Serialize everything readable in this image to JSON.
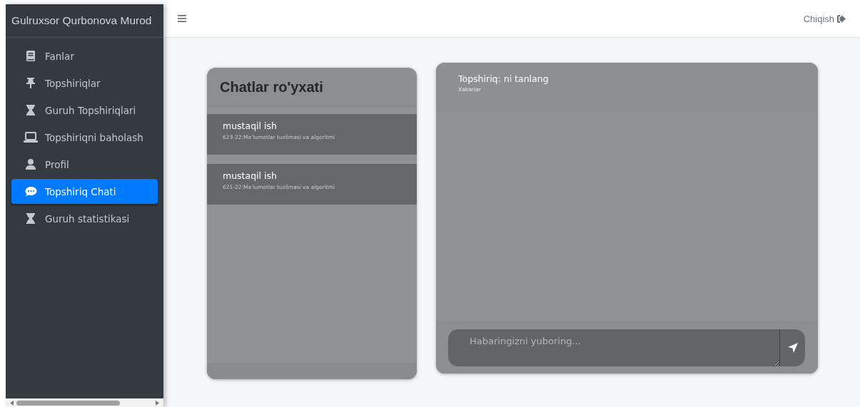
{
  "sidebar": {
    "title": "Gulruxsor Qurbonova Murod",
    "items": [
      {
        "label": "Fanlar",
        "selected": false
      },
      {
        "label": "Topshiriqlar",
        "selected": false
      },
      {
        "label": "Guruh Topshiriqlari",
        "selected": false
      },
      {
        "label": "Topshiriqni baholash",
        "selected": false
      },
      {
        "label": "Profil",
        "selected": false
      },
      {
        "label": "Topshiriq Chati",
        "selected": true
      },
      {
        "label": "Guruh statistikasi",
        "selected": false
      }
    ]
  },
  "header": {
    "logout": "Chiqish"
  },
  "chat_list": {
    "title": "Chatlar ro'yxati",
    "items": [
      {
        "title": "mustaqil ish",
        "subtitle": "623-22:Ma'lumotlar tuzilmasi va algoritmi"
      },
      {
        "title": "mustaqil ish",
        "subtitle": "621-22:Ma'lumotlar tuzilmasi va algoritmi"
      }
    ]
  },
  "chat": {
    "title": "Topshiriq: ni tanlang",
    "subtitle": "Xabarlar",
    "input": {
      "placeholder": "Habaringizni yuboring..."
    }
  }
}
